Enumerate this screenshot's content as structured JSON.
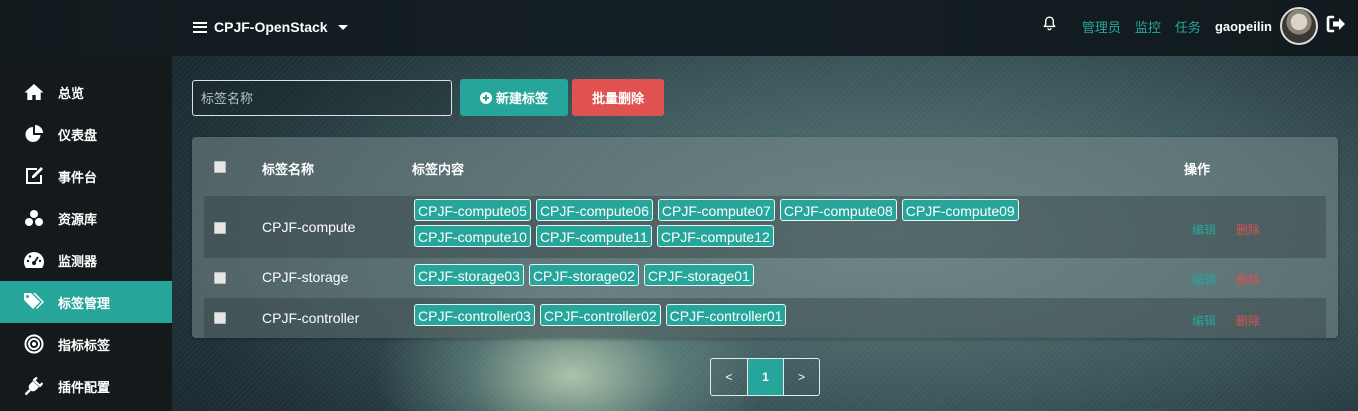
{
  "header": {
    "brand": "CPJF-OpenStack",
    "nav_links": [
      "管理员",
      "监控",
      "任务"
    ],
    "username": "gaopeilin"
  },
  "sidebar": {
    "items": [
      {
        "label": "总览",
        "icon": "home-icon"
      },
      {
        "label": "仪表盘",
        "icon": "pie-chart-icon"
      },
      {
        "label": "事件台",
        "icon": "edit-icon"
      },
      {
        "label": "资源库",
        "icon": "cubes-icon"
      },
      {
        "label": "监测器",
        "icon": "dashboard-gauge-icon"
      },
      {
        "label": "标签管理",
        "icon": "tags-icon",
        "active": true
      },
      {
        "label": "指标标签",
        "icon": "target-icon"
      },
      {
        "label": "插件配置",
        "icon": "plug-icon"
      }
    ]
  },
  "toolbar": {
    "search_placeholder": "标签名称",
    "new_label": "新建标签",
    "batch_delete_label": "批量删除"
  },
  "table": {
    "headers": {
      "name": "标签名称",
      "content": "标签内容",
      "actions": "操作"
    },
    "edit_label": "编辑",
    "delete_label": "删除",
    "rows": [
      {
        "name": "CPJF-compute",
        "tags": [
          "CPJF-compute05",
          "CPJF-compute06",
          "CPJF-compute07",
          "CPJF-compute08",
          "CPJF-compute09",
          "CPJF-compute10",
          "CPJF-compute11",
          "CPJF-compute12"
        ]
      },
      {
        "name": "CPJF-storage",
        "tags": [
          "CPJF-storage03",
          "CPJF-storage02",
          "CPJF-storage01"
        ]
      },
      {
        "name": "CPJF-controller",
        "tags": [
          "CPJF-controller03",
          "CPJF-controller02",
          "CPJF-controller01"
        ]
      }
    ]
  },
  "pagination": {
    "prev": "<",
    "current": "1",
    "next": ">"
  },
  "colors": {
    "accent": "#26a69a",
    "danger": "#e05250",
    "sidebar_bg": "#14191b"
  }
}
